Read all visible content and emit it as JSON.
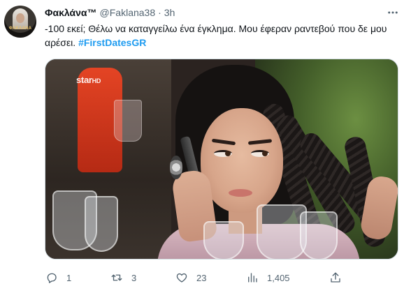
{
  "tweet": {
    "display_name": "Φακλάνα™",
    "handle": "@Faklana38",
    "separator": "·",
    "time": "3h",
    "text": "-100 εκεί; Θέλω να καταγγείλω ένα έγκλημα. Μου έφεραν ραντεβού που δε μου αρέσει.",
    "hashtag": "#FirstDatesGR",
    "media": {
      "watermark_main": "star",
      "watermark_suffix": "HD"
    },
    "avatar_logo": "ΦΑΚΛΑΝΑ"
  },
  "actions": {
    "reply_count": "1",
    "retweet_count": "3",
    "like_count": "23",
    "views_count": "1,405"
  },
  "icons": {
    "more": "more-icon",
    "reply": "reply-icon",
    "retweet": "retweet-icon",
    "like": "heart-icon",
    "views": "views-icon",
    "share": "share-icon"
  },
  "colors": {
    "text": "#0f1419",
    "secondary": "#536471",
    "link": "#1d9bf0",
    "border": "#cfd9de"
  }
}
